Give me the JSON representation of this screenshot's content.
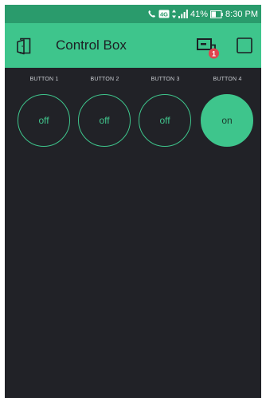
{
  "status_bar": {
    "network": "4G",
    "battery_percent": "41%",
    "time": "8:30 PM"
  },
  "app_bar": {
    "title": "Control Box",
    "notification_count": "1"
  },
  "buttons": [
    {
      "label": "BUTTON 1",
      "state": "off"
    },
    {
      "label": "BUTTON 2",
      "state": "off"
    },
    {
      "label": "BUTTON 3",
      "state": "off"
    },
    {
      "label": "BUTTON 4",
      "state": "on"
    }
  ],
  "colors": {
    "accent": "#3ec58c",
    "status_bar": "#2a9b6c",
    "background": "#212227"
  }
}
